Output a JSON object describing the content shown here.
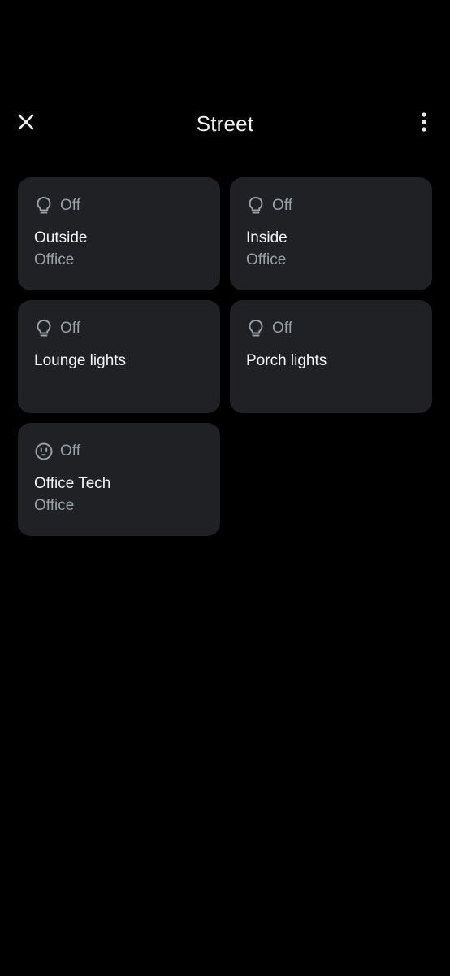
{
  "header": {
    "title": "Street",
    "close_icon": "close-icon",
    "more_icon": "more-vert-icon"
  },
  "colors": {
    "background": "#000000",
    "tile": "#202124",
    "primary_text": "#f1f3f4",
    "secondary_text": "#9aa0a6"
  },
  "devices": [
    {
      "icon": "lightbulb-icon",
      "status": "Off",
      "name": "Outside",
      "room": "Office"
    },
    {
      "icon": "lightbulb-icon",
      "status": "Off",
      "name": "Inside",
      "room": "Office"
    },
    {
      "icon": "lightbulb-icon",
      "status": "Off",
      "name": "Lounge lights",
      "room": ""
    },
    {
      "icon": "lightbulb-icon",
      "status": "Off",
      "name": "Porch lights",
      "room": ""
    },
    {
      "icon": "outlet-icon",
      "status": "Off",
      "name": "Office Tech",
      "room": "Office"
    }
  ]
}
